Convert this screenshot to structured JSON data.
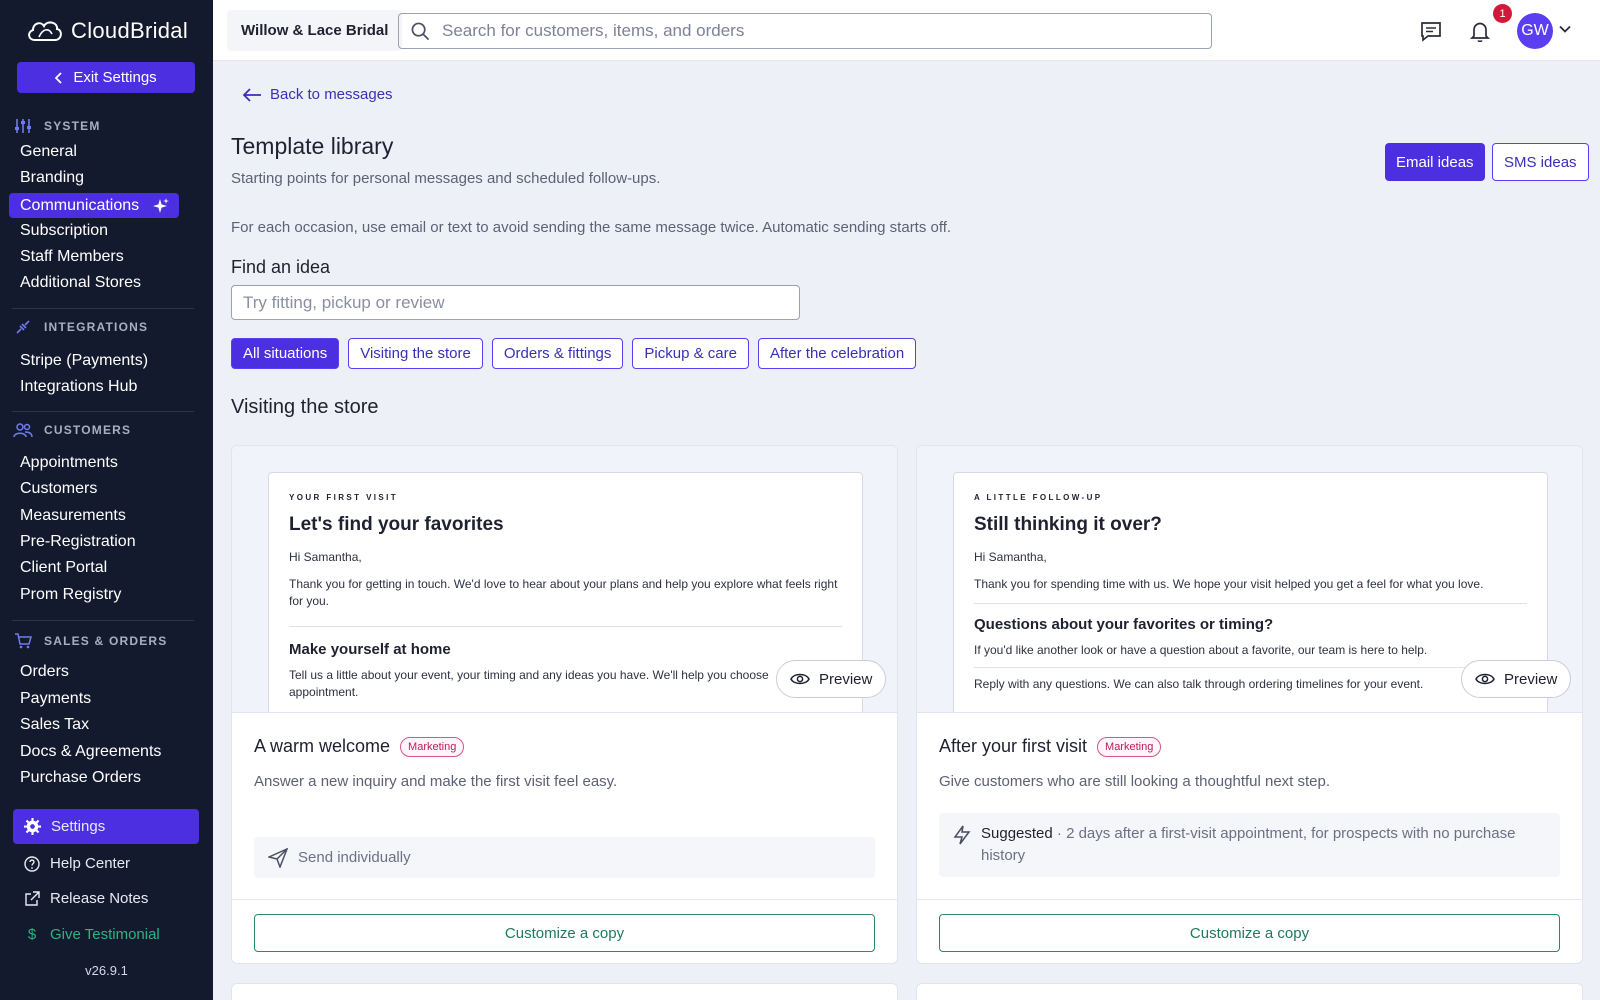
{
  "app": {
    "logo_text": "CloudBridal",
    "exit_settings": "Exit Settings",
    "version": "v26.9.1"
  },
  "sidebar": {
    "system": {
      "heading": "SYSTEM",
      "items": [
        "General",
        "Branding",
        "Communications",
        "Subscription",
        "Staff Members",
        "Additional Stores"
      ]
    },
    "integrations": {
      "heading": "INTEGRATIONS",
      "items": [
        "Stripe (Payments)",
        "Integrations Hub"
      ]
    },
    "customers": {
      "heading": "CUSTOMERS",
      "items": [
        "Appointments",
        "Customers",
        "Measurements",
        "Pre-Registration",
        "Client Portal",
        "Prom Registry"
      ]
    },
    "sales": {
      "heading": "SALES & ORDERS",
      "items": [
        "Orders",
        "Payments",
        "Sales Tax",
        "Docs & Agreements",
        "Purchase Orders"
      ]
    },
    "footer": {
      "settings": "Settings",
      "help": "Help Center",
      "release": "Release Notes",
      "testimonial": "Give Testimonial"
    }
  },
  "topbar": {
    "store": "Willow & Lace Bridal",
    "search_placeholder": "Search for customers, items, and orders",
    "notification_count": "1",
    "avatar_initials": "GW"
  },
  "page": {
    "back": "Back to messages",
    "title": "Template library",
    "subtitle": "Starting points for personal messages and scheduled follow-ups.",
    "email_ideas": "Email ideas",
    "sms_ideas": "SMS ideas",
    "info": "For each occasion, use email or text to avoid sending the same message twice. Automatic sending starts off.",
    "find_label": "Find an idea",
    "find_placeholder": "Try fitting, pickup or review",
    "filters": [
      "All situations",
      "Visiting the store",
      "Orders & fittings",
      "Pickup & care",
      "After the celebration"
    ],
    "group_title": "Visiting the store"
  },
  "cards": [
    {
      "eyebrow": "YOUR FIRST VISIT",
      "heading": "Let's find your favorites",
      "greeting": "Hi Samantha,",
      "body": "Thank you for getting in touch. We'd love to hear about your plans and help you explore what feels right for you.",
      "heading2": "Make yourself at home",
      "body2": "Tell us a little about your event, your timing and any ideas you have. We'll help you choose appointment.",
      "preview": "Preview",
      "title": "A warm welcome",
      "badge": "Marketing",
      "desc": "Answer a new inquiry and make the first visit feel easy.",
      "send": "Send individually",
      "customize": "Customize a copy"
    },
    {
      "eyebrow": "A LITTLE FOLLOW-UP",
      "heading": "Still thinking it over?",
      "greeting": "Hi Samantha,",
      "body": "Thank you for spending time with us. We hope your visit helped you get a feel for what you love.",
      "heading2": "Questions about your favorites or timing?",
      "body2": "If you'd like another look or have a question about a favorite, our team is here to help.",
      "body3": "Reply with any questions. We can also talk through ordering timelines for your event.",
      "preview": "Preview",
      "title": "After your first visit",
      "badge": "Marketing",
      "desc": "Give customers who are still looking a thoughtful next step.",
      "suggested_label": "Suggested",
      "suggested_text": " · 2 days after a first-visit appointment, for prospects with no purchase history",
      "customize": "Customize a copy"
    }
  ]
}
